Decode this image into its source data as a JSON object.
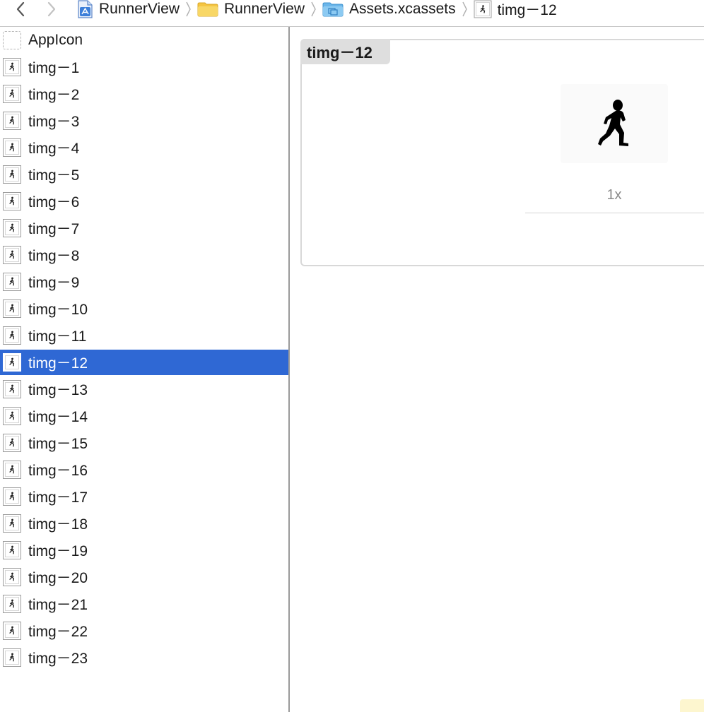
{
  "breadcrumb": [
    {
      "label": "RunnerView",
      "icon": "xcode-project-icon"
    },
    {
      "label": "RunnerView",
      "icon": "folder-icon"
    },
    {
      "label": "Assets.xcassets",
      "icon": "asset-catalog-icon"
    },
    {
      "label": "timg－12",
      "icon": "image-set-icon"
    }
  ],
  "sidebar": {
    "items": [
      {
        "label": "AppIcon",
        "icon": "app-icon-placeholder"
      },
      {
        "label": "timg－1",
        "icon": "image-set-icon"
      },
      {
        "label": "timg－2",
        "icon": "image-set-icon"
      },
      {
        "label": "timg－3",
        "icon": "image-set-icon"
      },
      {
        "label": "timg－4",
        "icon": "image-set-icon"
      },
      {
        "label": "timg－5",
        "icon": "image-set-icon"
      },
      {
        "label": "timg－6",
        "icon": "image-set-icon"
      },
      {
        "label": "timg－7",
        "icon": "image-set-icon"
      },
      {
        "label": "timg－8",
        "icon": "image-set-icon"
      },
      {
        "label": "timg－9",
        "icon": "image-set-icon"
      },
      {
        "label": "timg－10",
        "icon": "image-set-icon"
      },
      {
        "label": "timg－11",
        "icon": "image-set-icon"
      },
      {
        "label": "timg－12",
        "icon": "image-set-icon",
        "selected": true
      },
      {
        "label": "timg－13",
        "icon": "image-set-icon"
      },
      {
        "label": "timg－14",
        "icon": "image-set-icon"
      },
      {
        "label": "timg－15",
        "icon": "image-set-icon"
      },
      {
        "label": "timg－16",
        "icon": "image-set-icon"
      },
      {
        "label": "timg－17",
        "icon": "image-set-icon"
      },
      {
        "label": "timg－18",
        "icon": "image-set-icon"
      },
      {
        "label": "timg－19",
        "icon": "image-set-icon"
      },
      {
        "label": "timg－20",
        "icon": "image-set-icon"
      },
      {
        "label": "timg－21",
        "icon": "image-set-icon"
      },
      {
        "label": "timg－22",
        "icon": "image-set-icon"
      },
      {
        "label": "timg－23",
        "icon": "image-set-icon"
      }
    ]
  },
  "editor": {
    "set_title": "timg－12",
    "slot_label": "1x",
    "slot_image": "runner-silhouette-icon"
  },
  "colors": {
    "selection": "#2f68d4",
    "folder": "#f5c542",
    "catalog": "#6bb6ea"
  }
}
